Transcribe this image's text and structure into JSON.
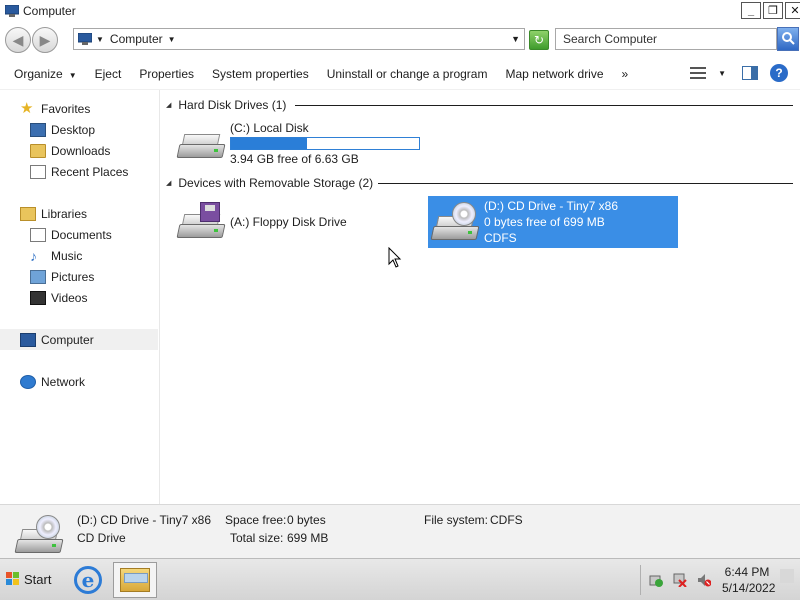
{
  "window": {
    "title": "Computer",
    "icons": {
      "app": "computer-icon",
      "minimize": "minimize-icon",
      "maximize": "restore-icon",
      "close": "close-icon"
    },
    "controls": {
      "minimize": "_",
      "maximize": "❐",
      "close": "✕"
    }
  },
  "address_bar": {
    "breadcrumb": "Computer",
    "search_placeholder": "Search Computer",
    "icons": [
      "back-arrow-icon",
      "forward-arrow-icon",
      "computer-icon",
      "chevron-down-icon",
      "refresh-go-icon",
      "search-icon"
    ]
  },
  "command_bar": {
    "items": [
      "Organize",
      "Eject",
      "Properties",
      "System properties",
      "Uninstall or change a program",
      "Map network drive"
    ],
    "overflow": "»",
    "icons": [
      "change-view-icon",
      "preview-pane-icon",
      "help-icon"
    ]
  },
  "sidebar": {
    "favorites": {
      "label": "Favorites",
      "items": [
        "Desktop",
        "Downloads",
        "Recent Places"
      ]
    },
    "libraries": {
      "label": "Libraries",
      "items": [
        "Documents",
        "Music",
        "Pictures",
        "Videos"
      ]
    },
    "computer": "Computer",
    "network": "Network"
  },
  "main": {
    "groups": [
      {
        "header": "Hard Disk Drives (1)",
        "drives": [
          {
            "name": "(C:) Local Disk",
            "free_text": "3.94 GB free of 6.63 GB",
            "used_fraction": 0.406,
            "icon": "hard-disk-icon"
          }
        ]
      },
      {
        "header": "Devices with Removable Storage (2)",
        "drives": [
          {
            "name": "(A:) Floppy Disk Drive",
            "icon": "floppy-drive-icon"
          },
          {
            "name": "(D:) CD Drive - Tiny7 x86",
            "free_text": "0 bytes free of 699 MB",
            "filesystem": "CDFS",
            "icon": "cd-drive-icon",
            "selected": true
          }
        ]
      }
    ]
  },
  "details_pane": {
    "name": "(D:) CD Drive - Tiny7 x86",
    "type": "CD Drive",
    "space_free_label": "Space free:",
    "space_free": "0 bytes",
    "total_size_label": "Total size:",
    "total_size": "699 MB",
    "filesystem_label": "File system:",
    "filesystem": "CDFS"
  },
  "taskbar": {
    "start_label": "Start",
    "apps": [
      "internet-explorer-icon",
      "windows-explorer-icon"
    ],
    "tray_icons": [
      "action-center-icon",
      "network-disconnected-icon",
      "volume-muted-icon"
    ],
    "time": "6:44 PM",
    "date": "5/14/2022"
  },
  "colors": {
    "selection": "#3a8ee6",
    "capacity_bar": "#2a7ed8",
    "accent_blue": "#2a6bc8"
  }
}
